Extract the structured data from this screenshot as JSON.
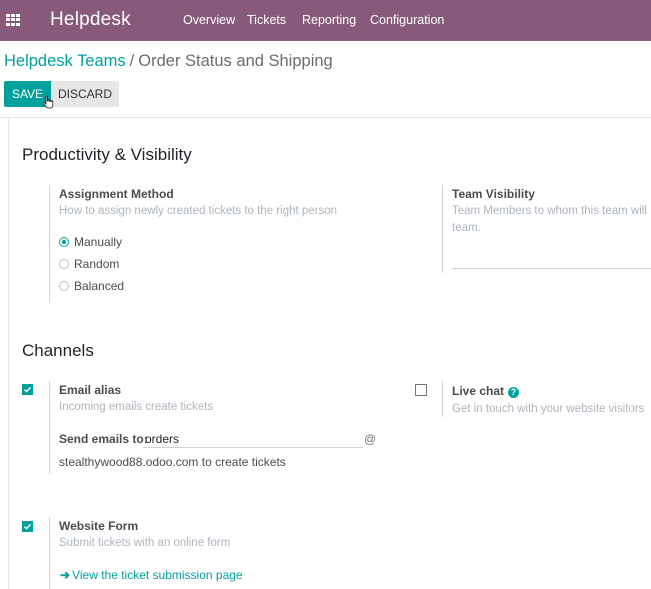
{
  "navbar": {
    "brand": "Helpdesk",
    "menu": [
      "Overview",
      "Tickets",
      "Reporting",
      "Configuration"
    ]
  },
  "breadcrumb": {
    "parent": "Helpdesk Teams",
    "separator": "/",
    "current": "Order Status and Shipping"
  },
  "buttons": {
    "save": "SAVE",
    "discard": "DISCARD"
  },
  "productivity": {
    "title": "Productivity & Visibility",
    "assignment": {
      "title": "Assignment Method",
      "description": "How to assign newly created tickets to the right person",
      "options": [
        "Manually",
        "Random",
        "Balanced"
      ],
      "selected": "Manually"
    },
    "visibility": {
      "title": "Team Visibility",
      "description_line1": "Team Members to whom this team will",
      "description_line2": "team."
    }
  },
  "channels": {
    "title": "Channels",
    "email_alias": {
      "title": "Email alias",
      "description": "Incoming emails create tickets",
      "checked": true,
      "send_label": "Send emails to:",
      "value": "orders",
      "at": "@",
      "domain_text": "stealthywood88.odoo.com to create tickets"
    },
    "live_chat": {
      "title": "Live chat",
      "description": "Get in touch with your website visitors",
      "checked": false,
      "help": "?"
    },
    "website_form": {
      "title": "Website Form",
      "description": "Submit tickets with an online form",
      "checked": true,
      "link_text": "View the ticket submission page"
    }
  },
  "colors": {
    "navbar": "#875a7b",
    "accent": "#00a09d"
  }
}
